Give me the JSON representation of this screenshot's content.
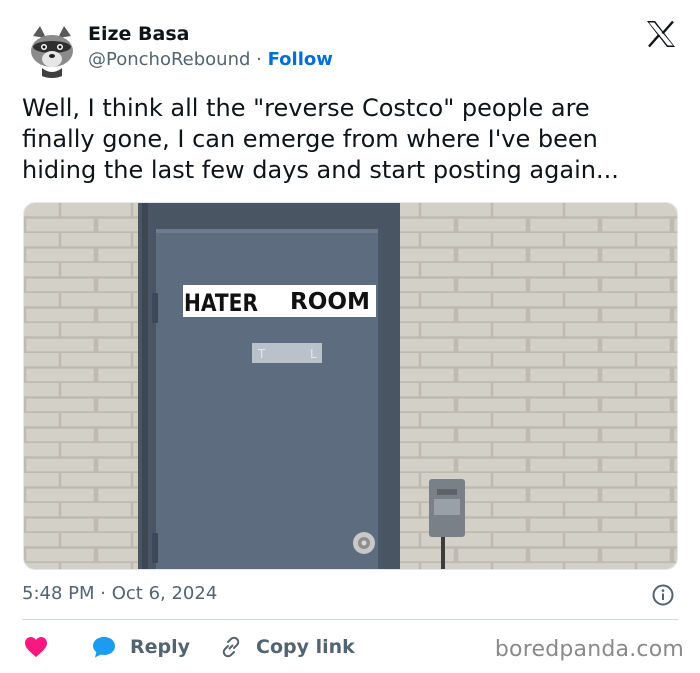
{
  "author": {
    "display_name": "Eize Basa",
    "handle": "@PonchoRebound",
    "separator": "·",
    "follow_label": "Follow"
  },
  "tweet": {
    "text": "Well, I think all the \"reverse Costco\" people are\nfinally gone, I can emerge from where I've been\nhiding the last few days and start posting again...",
    "time": "5:48 PM",
    "date_separator": "·",
    "date": "Oct 6, 2024"
  },
  "photo": {
    "sign_word_1": "HATER",
    "sign_word_2": "ROOM",
    "small_sign_left": "T",
    "small_sign_right": "L"
  },
  "actions": {
    "reply_label": "Reply",
    "copy_link_label": "Copy link"
  },
  "watermark": "boredpanda.com",
  "colors": {
    "link_blue": "#006fd6",
    "heart_red": "#f91880",
    "reply_blue": "#1d9bf0",
    "muted_text": "#536471",
    "door_blue": "#5d6c7e",
    "brick": "#cfccc4"
  },
  "icons": {
    "x_logo": "x-logo-icon",
    "info": "info-icon",
    "like": "heart-icon",
    "reply": "speech-bubble-icon",
    "copy": "link-icon"
  }
}
